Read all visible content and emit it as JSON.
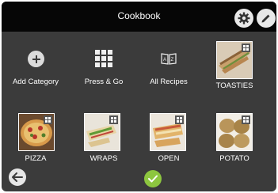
{
  "header": {
    "title": "Cookbook",
    "settings_icon": "gear-icon",
    "edit_icon": "pencil-icon"
  },
  "tiles": [
    {
      "label": "Add Category",
      "icon": "plus-icon"
    },
    {
      "label": "Press & Go",
      "icon": "grid-icon"
    },
    {
      "label": "All Recipes",
      "icon": "open-book-icon"
    },
    {
      "label": "TOASTIES",
      "icon": "toastie-photo"
    },
    {
      "label": "PIZZA",
      "icon": "pizza-photo"
    },
    {
      "label": "WRAPS",
      "icon": "wraps-photo"
    },
    {
      "label": "OPEN",
      "icon": "open-sandwich-photo"
    },
    {
      "label": "POTATO",
      "icon": "potato-photo"
    }
  ],
  "footer": {
    "back_icon": "arrow-left-icon",
    "confirm_icon": "checkmark-icon"
  },
  "colors": {
    "background": "#3b3b3b",
    "topbar": "#060606",
    "confirm": "#8dc63f",
    "text": "#ffffff"
  }
}
